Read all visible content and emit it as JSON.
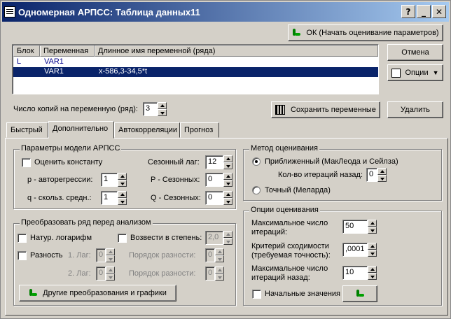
{
  "window": {
    "title": "Одномерная АРПСС: Таблица данных11",
    "help_glyph": "?",
    "min_glyph": "_",
    "close_glyph": "✕"
  },
  "buttons": {
    "ok": "ОК (Начать оценивание параметров)",
    "cancel": "Отмена",
    "options": "Опции",
    "save_vars": "Сохранить переменные",
    "delete": "Удалить"
  },
  "list": {
    "headers": [
      "Блок",
      "Переменная",
      "Длинное имя переменной (ряда)"
    ],
    "rows": [
      {
        "block": "L",
        "variable": "VAR1",
        "long_name": ""
      },
      {
        "block": "",
        "variable": "VAR1",
        "long_name": "x-586,3-34,5*t"
      }
    ]
  },
  "copies": {
    "label": "Число копий на переменную (ряд):",
    "value": "3"
  },
  "tabs": [
    "Быстрый",
    "Дополнительно",
    "Автокорреляции",
    "Прогноз"
  ],
  "arima_params": {
    "title": "Параметры модели АРПСС",
    "estimate_const": "Оценить константу",
    "p_label": "p - авторегрессии:",
    "p_value": "1",
    "q_label": "q - скольз. средн.:",
    "q_value": "1",
    "season_lag_label": "Сезонный лаг:",
    "season_lag_value": "12",
    "P_label": "P - Сезонных:",
    "P_value": "0",
    "Q_label": "Q - Сезонных:",
    "Q_value": "0"
  },
  "transform": {
    "title": "Преобразовать ряд перед анализом",
    "natlog": "Натур. логарифм",
    "power": "Возвести в степень:",
    "power_value": "2,0",
    "diff": "Разность",
    "lag1": "1. Лаг:",
    "lag1_value": "0",
    "order1": "Порядок разности:",
    "order1_value": "0",
    "lag2": "2. Лаг:",
    "lag2_value": "0",
    "order2": "Порядок разности:",
    "order2_value": "0",
    "other_btn": "Другие преобразования и графики"
  },
  "method": {
    "title": "Метод оценивания",
    "approx": "Приближенный (МакЛеода и Сейлза)",
    "iter_back_label": "Кол-во итераций назад:",
    "iter_back_value": "0",
    "exact": "Точный (Меларда)"
  },
  "est_opts": {
    "title": "Опции оценивания",
    "max_iter_label1": "Максимальное число",
    "max_iter_label2": "итераций:",
    "max_iter_value": "50",
    "conv_label1": "Критерий сходимости",
    "conv_label2": "(требуемая точность):",
    "conv_value": ",0001",
    "max_back_label1": "Максимальное число",
    "max_back_label2": "итераций назад:",
    "max_back_value": "10",
    "init_values": "Начальные значения"
  }
}
